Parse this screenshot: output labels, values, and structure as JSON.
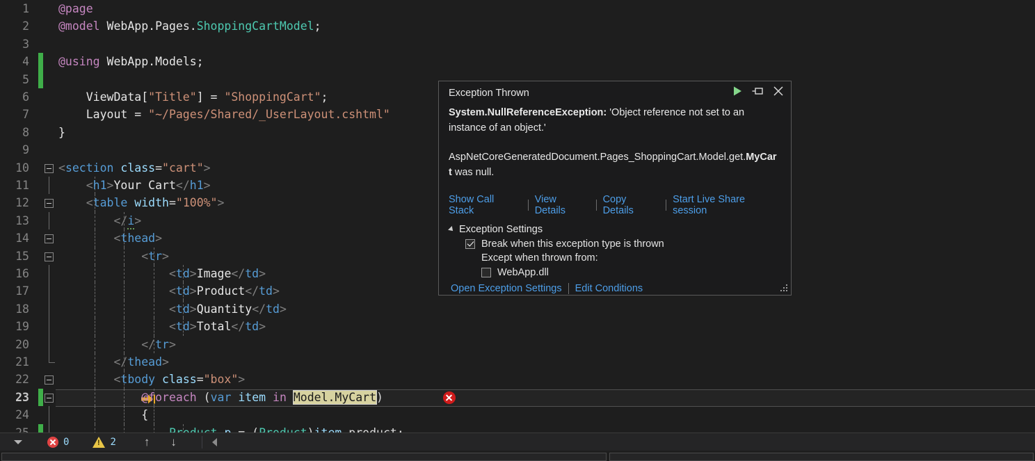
{
  "editor": {
    "lines": [
      {
        "num": "1",
        "indent_guides": [],
        "text_runs": [
          {
            "t": "@page",
            "c": "t-razor"
          }
        ]
      },
      {
        "num": "2",
        "indent_guides": [],
        "text_runs": [
          {
            "t": "@model",
            "c": "t-razor"
          },
          {
            "t": " WebApp.Pages.",
            "c": "t-white"
          },
          {
            "t": "ShoppingCartModel",
            "c": "t-type"
          },
          {
            "t": ";",
            "c": "t-white"
          }
        ]
      },
      {
        "num": "3",
        "indent_guides": [],
        "text_runs": []
      },
      {
        "num": "4",
        "indent_guides": [],
        "text_runs": [
          {
            "t": "@using",
            "c": "t-razor"
          },
          {
            "t": " WebApp.Models;",
            "c": "t-white"
          }
        ]
      },
      {
        "num": "5",
        "indent_guides": [],
        "text_runs": []
      },
      {
        "num": "6",
        "indent_guides": [],
        "text_runs": [
          {
            "t": "    ViewData[",
            "c": "t-white"
          },
          {
            "t": "\"Title\"",
            "c": "t-str"
          },
          {
            "t": "] = ",
            "c": "t-white"
          },
          {
            "t": "\"ShoppingCart\"",
            "c": "t-str"
          },
          {
            "t": ";",
            "c": "t-white"
          }
        ]
      },
      {
        "num": "7",
        "indent_guides": [],
        "text_runs": [
          {
            "t": "    Layout = ",
            "c": "t-white"
          },
          {
            "t": "\"~/Pages/Shared/_UserLayout.cshtml\"",
            "c": "t-str"
          }
        ]
      },
      {
        "num": "8",
        "indent_guides": [],
        "text_runs": [
          {
            "t": "}",
            "c": "t-white"
          }
        ]
      },
      {
        "num": "9",
        "indent_guides": [],
        "text_runs": []
      },
      {
        "num": "10",
        "indent_guides": [],
        "text_runs": [
          {
            "t": "<",
            "c": "t-delim"
          },
          {
            "t": "section",
            "c": "t-tag"
          },
          {
            "t": " class",
            "c": "t-attr"
          },
          {
            "t": "=",
            "c": "t-plain"
          },
          {
            "t": "\"cart\"",
            "c": "t-str"
          },
          {
            "t": ">",
            "c": "t-delim"
          }
        ]
      },
      {
        "num": "11",
        "indent_guides": [
          136
        ],
        "text_runs": [
          {
            "t": "    <",
            "c": "t-delim"
          },
          {
            "t": "h1",
            "c": "t-tag"
          },
          {
            "t": ">",
            "c": "t-delim"
          },
          {
            "t": "Your Cart",
            "c": "t-white"
          },
          {
            "t": "</",
            "c": "t-delim"
          },
          {
            "t": "h1",
            "c": "t-tag"
          },
          {
            "t": ">",
            "c": "t-delim"
          }
        ]
      },
      {
        "num": "12",
        "indent_guides": [
          136
        ],
        "text_runs": [
          {
            "t": "    <",
            "c": "t-delim"
          },
          {
            "t": "table",
            "c": "t-tag"
          },
          {
            "t": " width",
            "c": "t-attr"
          },
          {
            "t": "=",
            "c": "t-plain"
          },
          {
            "t": "\"100%\"",
            "c": "t-str"
          },
          {
            "t": ">",
            "c": "t-delim"
          }
        ]
      },
      {
        "num": "13",
        "indent_guides": [
          136,
          178
        ],
        "text_runs": [
          {
            "t": "        </",
            "c": "t-delim"
          },
          {
            "t": "i",
            "c": "t-tag",
            "squiggle": true
          },
          {
            "t": ">",
            "c": "t-delim"
          }
        ]
      },
      {
        "num": "14",
        "indent_guides": [
          136,
          178
        ],
        "text_runs": [
          {
            "t": "        <",
            "c": "t-delim"
          },
          {
            "t": "thead",
            "c": "t-tag"
          },
          {
            "t": ">",
            "c": "t-delim"
          }
        ]
      },
      {
        "num": "15",
        "indent_guides": [
          136,
          178,
          221
        ],
        "text_runs": [
          {
            "t": "            <",
            "c": "t-delim"
          },
          {
            "t": "tr",
            "c": "t-tag"
          },
          {
            "t": ">",
            "c": "t-delim"
          }
        ]
      },
      {
        "num": "16",
        "indent_guides": [
          136,
          178,
          221,
          263
        ],
        "text_runs": [
          {
            "t": "                <",
            "c": "t-delim"
          },
          {
            "t": "td",
            "c": "t-tag"
          },
          {
            "t": ">",
            "c": "t-delim"
          },
          {
            "t": "Image",
            "c": "t-white"
          },
          {
            "t": "</",
            "c": "t-delim"
          },
          {
            "t": "td",
            "c": "t-tag"
          },
          {
            "t": ">",
            "c": "t-delim"
          }
        ]
      },
      {
        "num": "17",
        "indent_guides": [
          136,
          178,
          221,
          263
        ],
        "text_runs": [
          {
            "t": "                <",
            "c": "t-delim"
          },
          {
            "t": "td",
            "c": "t-tag"
          },
          {
            "t": ">",
            "c": "t-delim"
          },
          {
            "t": "Product",
            "c": "t-white"
          },
          {
            "t": "</",
            "c": "t-delim"
          },
          {
            "t": "td",
            "c": "t-tag"
          },
          {
            "t": ">",
            "c": "t-delim"
          }
        ]
      },
      {
        "num": "18",
        "indent_guides": [
          136,
          178,
          221,
          263
        ],
        "text_runs": [
          {
            "t": "                <",
            "c": "t-delim"
          },
          {
            "t": "td",
            "c": "t-tag"
          },
          {
            "t": ">",
            "c": "t-delim"
          },
          {
            "t": "Quantity",
            "c": "t-white"
          },
          {
            "t": "</",
            "c": "t-delim"
          },
          {
            "t": "td",
            "c": "t-tag"
          },
          {
            "t": ">",
            "c": "t-delim"
          }
        ]
      },
      {
        "num": "19",
        "indent_guides": [
          136,
          178,
          221,
          263
        ],
        "text_runs": [
          {
            "t": "                <",
            "c": "t-delim"
          },
          {
            "t": "td",
            "c": "t-tag"
          },
          {
            "t": ">",
            "c": "t-delim"
          },
          {
            "t": "Total",
            "c": "t-white"
          },
          {
            "t": "</",
            "c": "t-delim"
          },
          {
            "t": "td",
            "c": "t-tag"
          },
          {
            "t": ">",
            "c": "t-delim"
          }
        ]
      },
      {
        "num": "20",
        "indent_guides": [
          136,
          178,
          221
        ],
        "text_runs": [
          {
            "t": "            </",
            "c": "t-delim"
          },
          {
            "t": "tr",
            "c": "t-tag"
          },
          {
            "t": ">",
            "c": "t-delim"
          }
        ]
      },
      {
        "num": "21",
        "indent_guides": [
          136,
          178
        ],
        "text_runs": [
          {
            "t": "        </",
            "c": "t-delim"
          },
          {
            "t": "thead",
            "c": "t-tag"
          },
          {
            "t": ">",
            "c": "t-delim"
          }
        ]
      },
      {
        "num": "22",
        "indent_guides": [
          136,
          178
        ],
        "text_runs": [
          {
            "t": "        <",
            "c": "t-delim"
          },
          {
            "t": "tbody",
            "c": "t-tag"
          },
          {
            "t": " class",
            "c": "t-attr"
          },
          {
            "t": "=",
            "c": "t-plain"
          },
          {
            "t": "\"box\"",
            "c": "t-str"
          },
          {
            "t": ">",
            "c": "t-delim"
          }
        ]
      },
      {
        "num": "23",
        "indent_guides": [
          136,
          178,
          221
        ],
        "text_runs": [
          {
            "t": "            ",
            "c": "t-white"
          },
          {
            "t": "@foreach",
            "c": "t-razor"
          },
          {
            "t": " (",
            "c": "t-plain"
          },
          {
            "t": "var",
            "c": "t-kw"
          },
          {
            "t": " ",
            "c": "t-plain"
          },
          {
            "t": "item",
            "c": "t-ident"
          },
          {
            "t": " ",
            "c": "t-plain"
          },
          {
            "t": "in",
            "c": "t-razor"
          },
          {
            "t": " ",
            "c": "t-plain"
          },
          {
            "t": "Model.MyCart",
            "c": "hl-sel"
          },
          {
            "t": ")",
            "c": "t-plain"
          }
        ]
      },
      {
        "num": "24",
        "indent_guides": [
          136,
          178,
          221
        ],
        "text_runs": [
          {
            "t": "            {",
            "c": "t-white"
          }
        ]
      },
      {
        "num": "25",
        "indent_guides": [
          136,
          178,
          221,
          263
        ],
        "text_runs": [
          {
            "t": "                ",
            "c": "t-white"
          },
          {
            "t": "Product",
            "c": "t-type"
          },
          {
            "t": " ",
            "c": "t-plain"
          },
          {
            "t": "p",
            "c": "t-ident"
          },
          {
            "t": " = (",
            "c": "t-plain"
          },
          {
            "t": "Product",
            "c": "t-type"
          },
          {
            "t": ")",
            "c": "t-plain"
          },
          {
            "t": "item",
            "c": "t-ident"
          },
          {
            "t": ".product;",
            "c": "t-plain"
          }
        ]
      }
    ],
    "change_bar_lines": [
      "4",
      "5",
      "23",
      "25"
    ],
    "fold_lines": [
      "10",
      "12",
      "14",
      "15",
      "22",
      "23"
    ],
    "current_line": "23",
    "error_marker_line": "23",
    "colors": {
      "background": "#1e1e1e",
      "change_bar": "#3fae49",
      "selection_highlight": "#d7d2a0",
      "error_red": "#d01b1b",
      "step_arrow": "#e8a829"
    }
  },
  "exception_dialog": {
    "title": "Exception Thrown",
    "actions": {
      "continue": "continue-icon",
      "pin": "pin-icon",
      "close": "close-icon"
    },
    "message_type": "System.NullReferenceException:",
    "message_body": " 'Object reference not set to an instance of an object.'",
    "detail_prefix": "AspNetCoreGeneratedDocument.Pages_ShoppingCart.Model.get.",
    "detail_bold": "MyCart",
    "detail_suffix": " was null.",
    "links": [
      "Show Call Stack",
      "View Details",
      "Copy Details",
      "Start Live Share session"
    ],
    "settings_header": "Exception Settings",
    "break_checkbox_label": "Break when this exception type is thrown",
    "break_checkbox_checked": true,
    "except_when_label": "Except when thrown from:",
    "module_checkbox_label": "WebApp.dll",
    "module_checkbox_checked": false,
    "footer_links": [
      "Open Exception Settings",
      "Edit Conditions"
    ],
    "link_color": "#4d9ee8"
  },
  "bottom_bar": {
    "dropdown": "chevron-down-icon",
    "error_icon": "error-icon",
    "error_count": "0",
    "warning_icon": "warning-icon",
    "warning_count": "2",
    "up_arrow": "↑",
    "down_arrow": "↓",
    "back_arrow": "back-arrow-icon"
  }
}
